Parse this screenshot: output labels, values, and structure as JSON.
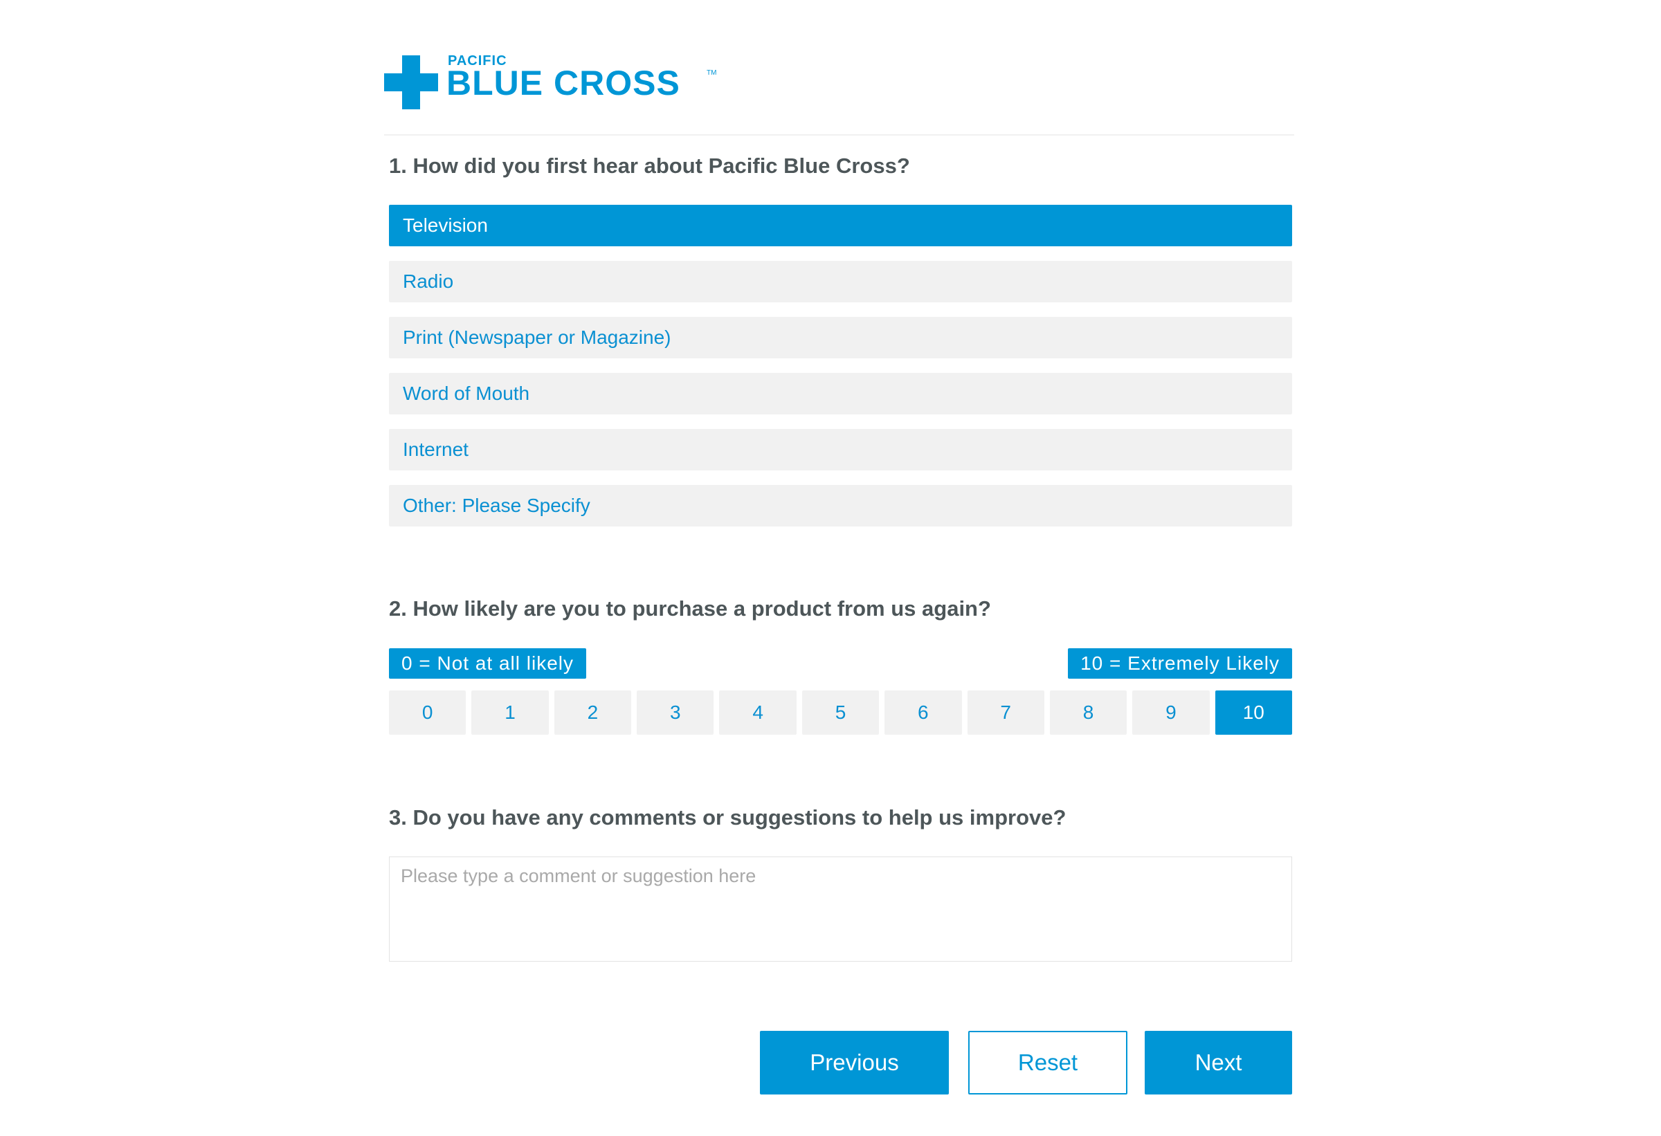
{
  "logo": {
    "pacific": "PACIFIC",
    "blue_cross": "BLUE CROSS",
    "tm": "TM",
    "color": "#0096d6"
  },
  "question1": {
    "text": "1. How did you first hear about Pacific Blue Cross?",
    "selected_index": 0,
    "options": [
      "Television",
      "Radio",
      "Print (Newspaper or Magazine)",
      "Word of Mouth",
      "Internet",
      "Other: Please Specify"
    ]
  },
  "question2": {
    "text": "2. How likely are you to purchase a product from us again?",
    "low_label": "0 = Not at all likely",
    "high_label": "10 = Extremely Likely",
    "scale": [
      "0",
      "1",
      "2",
      "3",
      "4",
      "5",
      "6",
      "7",
      "8",
      "9",
      "10"
    ],
    "selected_value": "10"
  },
  "question3": {
    "text": "3. Do you have any comments or suggestions to help us improve?",
    "placeholder": "Please type a comment or suggestion here",
    "value": ""
  },
  "buttons": {
    "previous": "Previous",
    "reset": "Reset",
    "next": "Next"
  },
  "colors": {
    "accent": "#0096d6",
    "option_bg": "#f1f1f1",
    "question_text": "#4d5659"
  }
}
